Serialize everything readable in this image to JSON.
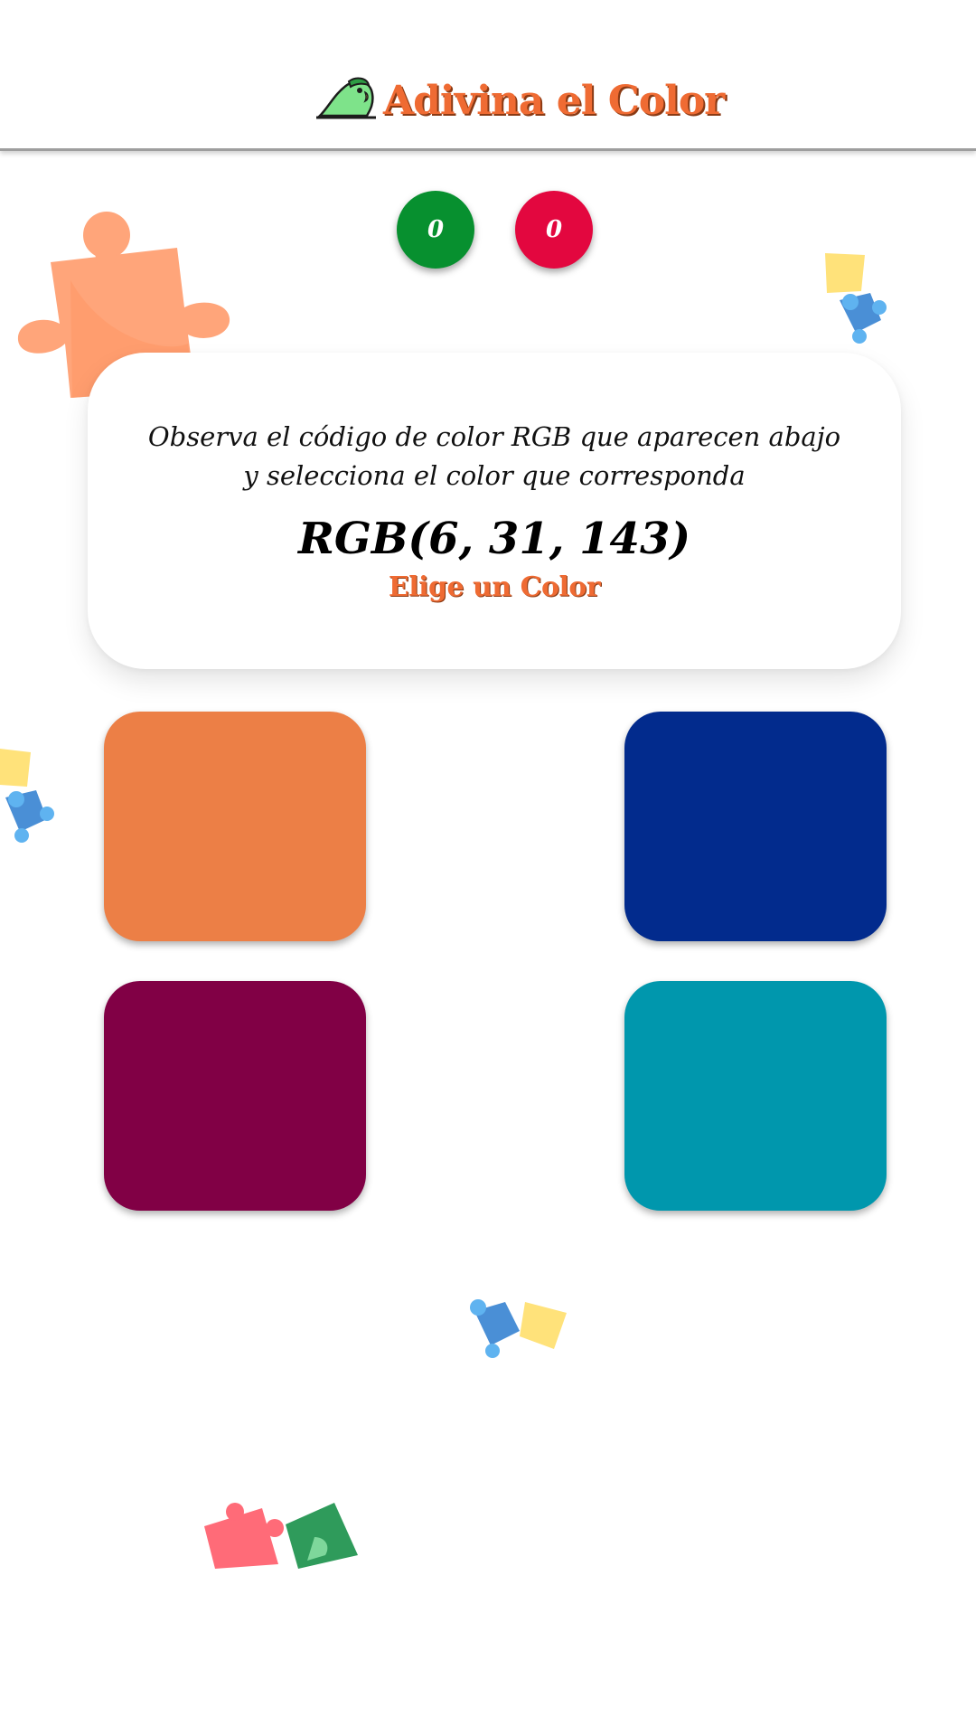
{
  "header": {
    "title": "Adivina el Color",
    "logo_icon": "parrot-icon"
  },
  "scores": {
    "correct": "0",
    "wrong": "0",
    "correct_color": "#07902f",
    "wrong_color": "#e3073f"
  },
  "card": {
    "instructions": "Observa el código de color RGB que aparecen abajo y selecciona el color que corresponda",
    "rgb_code": "RGB(6, 31, 143)",
    "choose_label": "Elige un Color"
  },
  "options": [
    {
      "color": "#ec7f46"
    },
    {
      "color": "#022b8d"
    },
    {
      "color": "#810045"
    },
    {
      "color": "#0097ad"
    }
  ],
  "colors": {
    "accent": "#ef6b33",
    "background": "#ffffff"
  },
  "decorations": [
    "puzzle-piece-icon",
    "puzzle-pieces-icon"
  ]
}
